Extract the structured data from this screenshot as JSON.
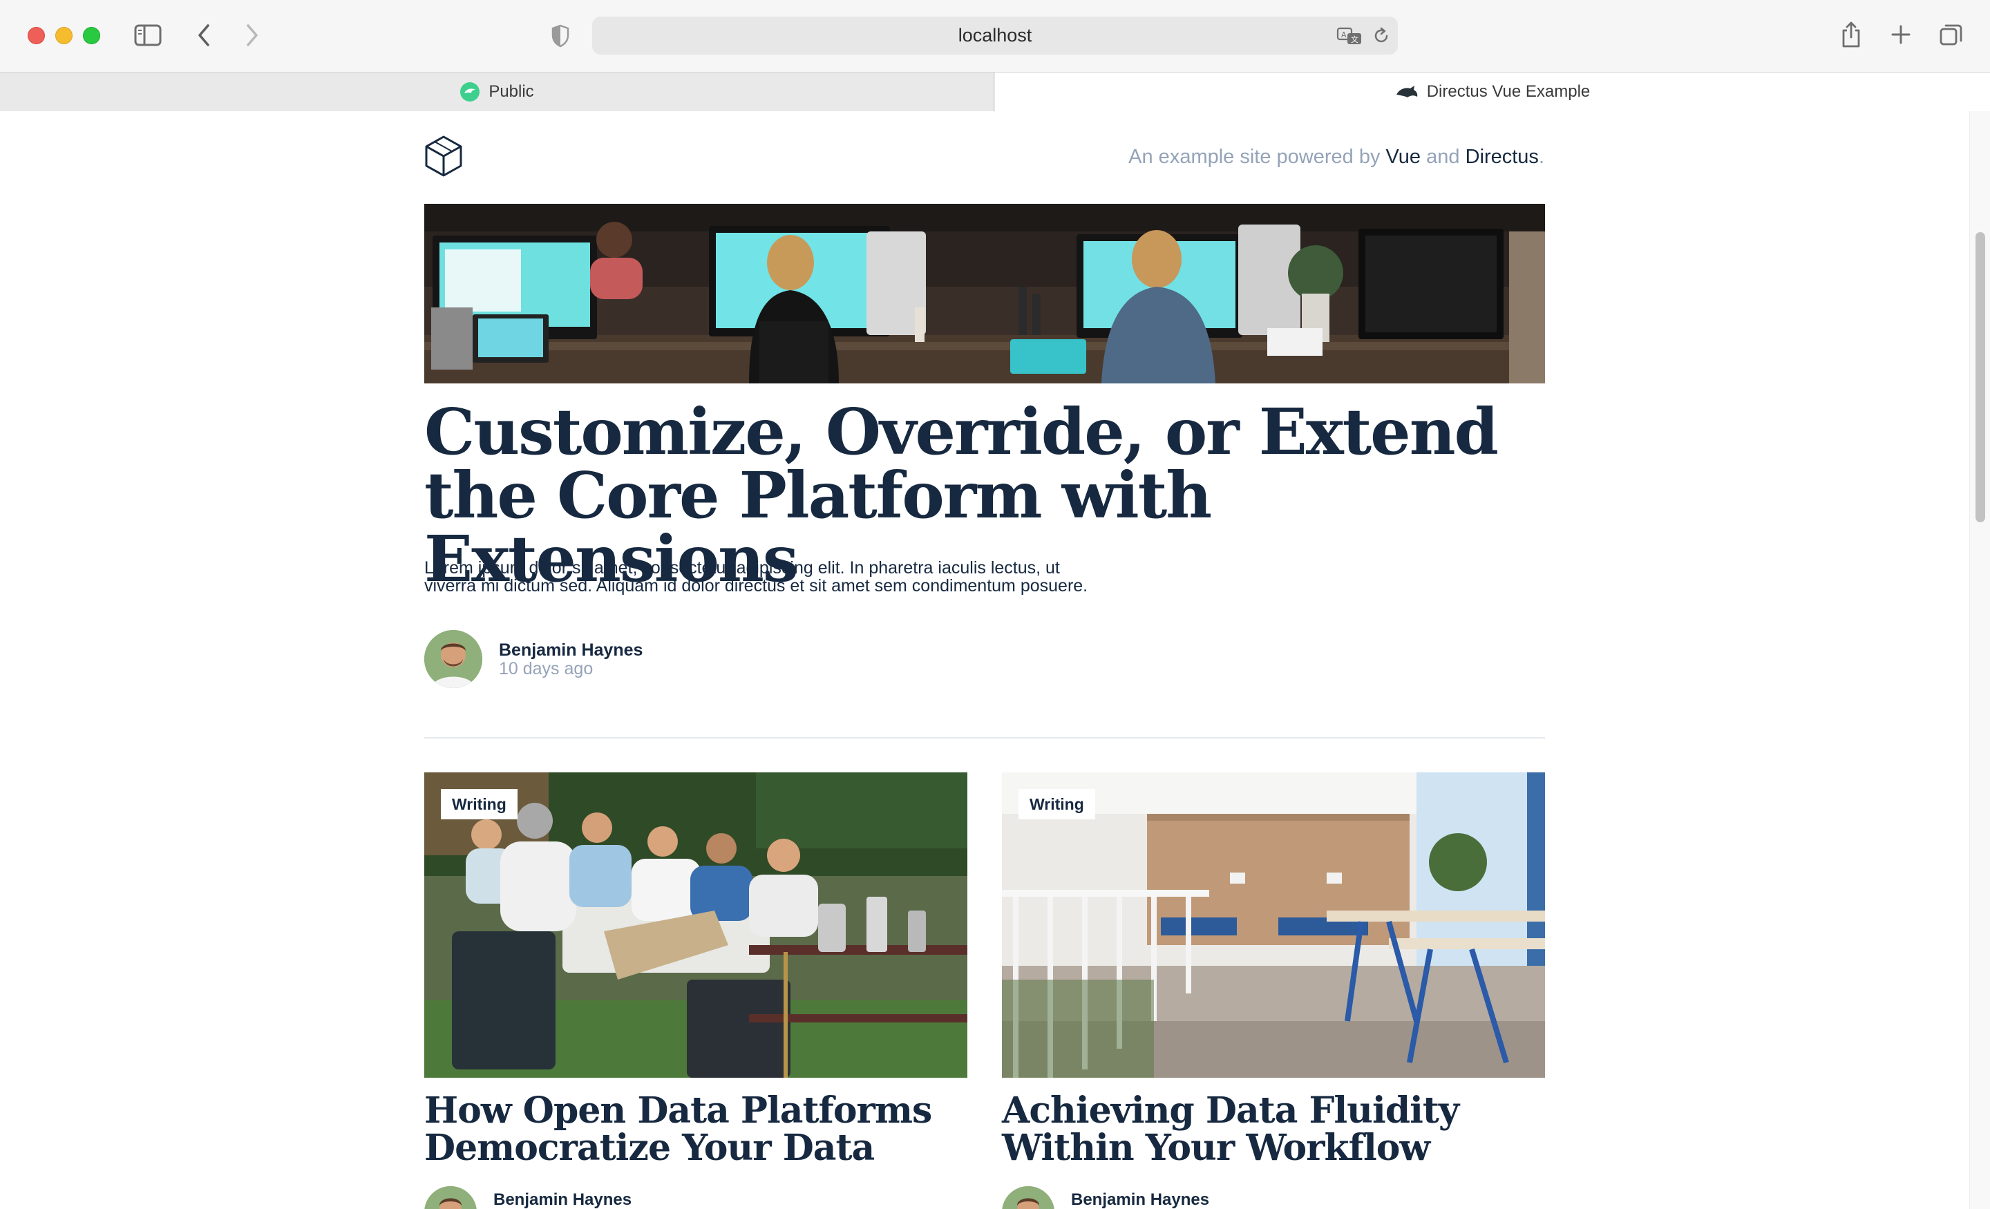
{
  "browser": {
    "url": "localhost",
    "tabs": [
      {
        "label": "Public",
        "active": false
      },
      {
        "label": "Directus Vue Example",
        "active": true
      }
    ]
  },
  "header": {
    "tagline_prefix": "An example site powered by",
    "tagline_vue": "Vue",
    "tagline_and": "and",
    "tagline_directus": "Directus",
    "tagline_end": "."
  },
  "hero": {
    "title": "Customize, Override, or Extend the Core Platform with Extensions",
    "description": "Lorem ipsum dolor sit amet, consectetur adipiscing elit. In pharetra iaculis lectus, ut viverra mi dictum sed. Aliquam id dolor directus et sit amet sem condimentum posuere.",
    "author": "Benjamin Haynes",
    "date": "10 days ago"
  },
  "articles": [
    {
      "tag": "Writing",
      "title": "How Open Data Platforms Democratize Your Data",
      "author": "Benjamin Haynes"
    },
    {
      "tag": "Writing",
      "title": "Achieving Data Fluidity Within Your Workflow",
      "author": "Benjamin Haynes"
    }
  ],
  "colors": {
    "heading": "#172940",
    "muted": "#95a3b8",
    "accent": "#3ecf8e"
  }
}
